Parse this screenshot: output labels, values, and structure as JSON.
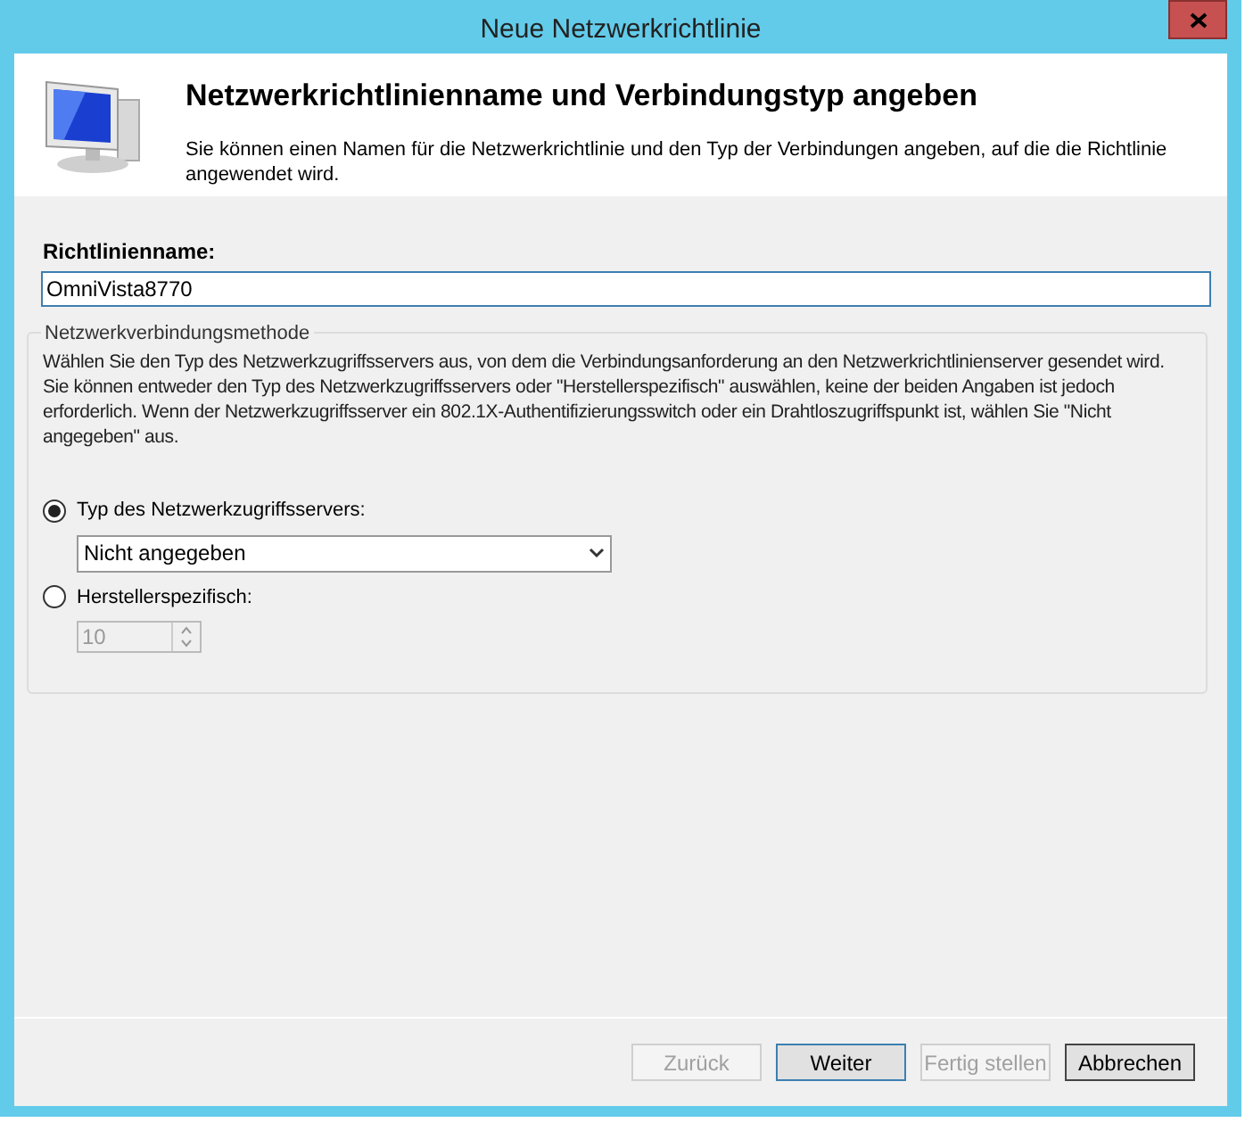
{
  "window": {
    "title": "Neue Netzwerkrichtlinie"
  },
  "header": {
    "title": "Netzwerkrichtlinienname und Verbindungstyp angeben",
    "description": "Sie können einen Namen für die Netzwerkrichtlinie und den Typ der Verbindungen angeben, auf die die Richtlinie angewendet wird."
  },
  "policy_name": {
    "label": "Richtlinienname:",
    "value": "OmniVista8770"
  },
  "method_group": {
    "title": "Netzwerkverbindungsmethode",
    "description": "Wählen Sie den Typ des Netzwerkzugriffsservers aus, von dem die Verbindungsanforderung an den Netzwerkrichtlinienserver gesendet wird. Sie können entweder den Typ des Netzwerkzugriffsservers oder \"Herstellerspezifisch\" auswählen, keine der beiden Angaben ist jedoch erforderlich. Wenn der Netzwerkzugriffsserver ein 802.1X-Authentifizierungsswitch oder ein Drahtloszugriffspunkt ist, wählen Sie \"Nicht angegeben\" aus.",
    "options": [
      {
        "kind": "dropdown",
        "label": "Typ des Netzwerkzugriffsservers:",
        "selected": true,
        "value": "Nicht angegeben",
        "disabled": false
      },
      {
        "kind": "spinner",
        "label": "Herstellerspezifisch:",
        "selected": false,
        "value": "10",
        "disabled": true
      }
    ]
  },
  "buttons": [
    {
      "label": "Zurück",
      "disabled": true,
      "default": false,
      "focused": false
    },
    {
      "label": "Weiter",
      "disabled": false,
      "default": true,
      "focused": false
    },
    {
      "label": "Fertig stellen",
      "disabled": true,
      "default": false,
      "focused": false
    },
    {
      "label": "Abbrechen",
      "disabled": false,
      "default": false,
      "focused": true
    }
  ]
}
